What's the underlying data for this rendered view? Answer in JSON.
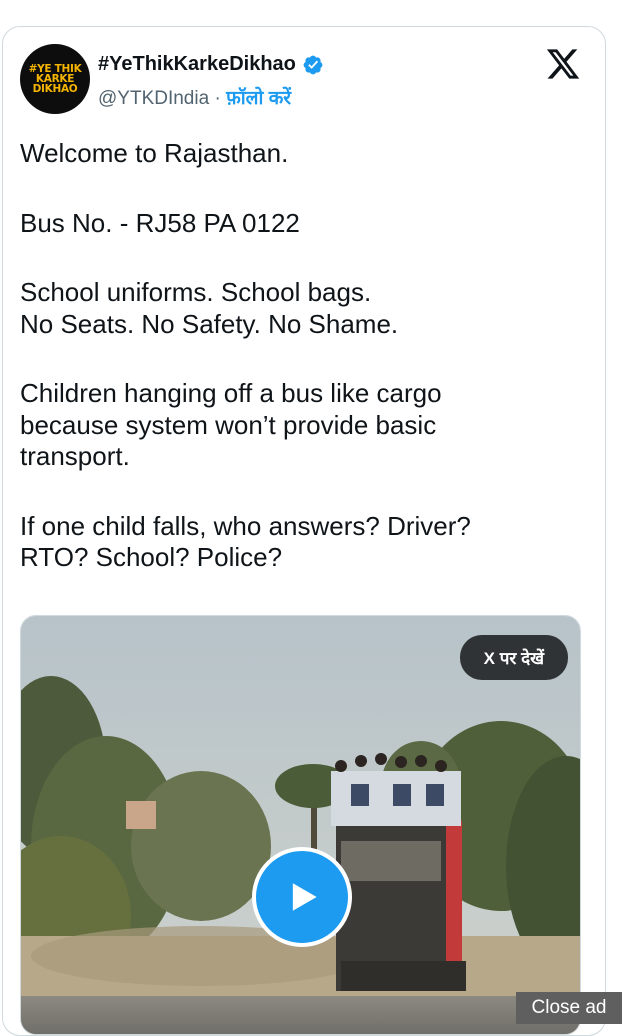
{
  "author": {
    "avatar_lines": [
      "#YE THIK",
      "KARKE",
      "DIKHAO"
    ],
    "display_name": "#YeThikKarkeDikhao",
    "handle": "@YTKDIndia",
    "separator": " · ",
    "follow_label": "फ़ॉलो करें"
  },
  "tweet": {
    "paragraphs": [
      [
        "Welcome to Rajasthan."
      ],
      [
        "Bus No. - RJ58 PA 0122"
      ],
      [
        "School uniforms. School bags.",
        "No Seats. No Safety. No Shame."
      ],
      [
        "Children hanging off a bus like cargo",
        "because system won’t provide basic",
        "transport."
      ],
      [
        "If one child falls, who answers? Driver?",
        "RTO? School? Police?"
      ]
    ]
  },
  "media": {
    "view_on_x_label": "X पर देखें"
  },
  "ad": {
    "close_label": "Close ad"
  },
  "colors": {
    "accent": "#1d9bf0",
    "text": "#0f1419",
    "muted": "#536471"
  },
  "icons": {
    "verified": "verified-badge-icon",
    "x_logo": "x-logo-icon",
    "play": "play-icon"
  }
}
